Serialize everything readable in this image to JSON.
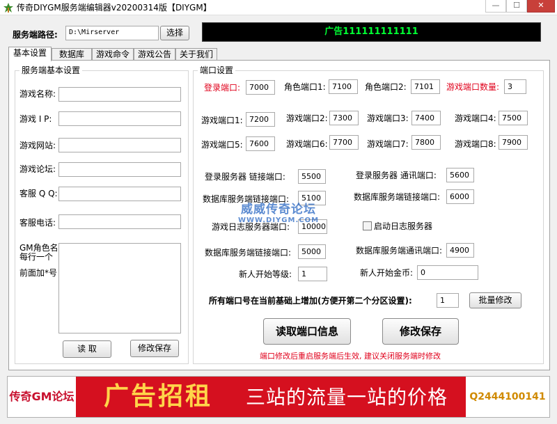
{
  "window": {
    "title": "传奇DIYGM服务端编辑器v20200314版【DIYGM】",
    "minimize_glyph": "—",
    "maximize_glyph": "☐",
    "close_glyph": "✕"
  },
  "server_path": {
    "label": "服务端路径:",
    "value": "D:\\Mirserver",
    "browse_label": "选择"
  },
  "ad_banner_text": "广告111111111111",
  "tabs": [
    {
      "label": "基本设置",
      "active": true
    },
    {
      "label": "数据库"
    },
    {
      "label": "游戏命令"
    },
    {
      "label": "游戏公告"
    },
    {
      "label": "关于我们"
    }
  ],
  "basic_settings": {
    "group_title": "服务端基本设置",
    "fields": [
      {
        "label": "游戏名称:",
        "value": ""
      },
      {
        "label": "游戏 I P:",
        "value": ""
      },
      {
        "label": "游戏网站:",
        "value": ""
      },
      {
        "label": "游戏论坛:",
        "value": ""
      },
      {
        "label": "客服 Q Q:",
        "value": ""
      },
      {
        "label": "客服电话:",
        "value": ""
      }
    ],
    "gm_label_lines": [
      "GM角色名:",
      "每行一个",
      "前面加*号"
    ],
    "gm_names": "",
    "read_button": "读 取",
    "save_button": "修改保存"
  },
  "ports": {
    "group_title": "端口设置",
    "row1": [
      {
        "label": "登录端口:",
        "value": "7000",
        "highlight": true
      },
      {
        "label": "角色端口1:",
        "value": "7100"
      },
      {
        "label": "角色端口2:",
        "value": "7101"
      },
      {
        "label": "游戏端口数量:",
        "value": "3",
        "highlight": true
      }
    ],
    "game_ports": [
      {
        "label": "游戏端口1:",
        "value": "7200"
      },
      {
        "label": "游戏端口2:",
        "value": "7300"
      },
      {
        "label": "游戏端口3:",
        "value": "7400"
      },
      {
        "label": "游戏端口4:",
        "value": "7500"
      },
      {
        "label": "游戏端口5:",
        "value": "7600"
      },
      {
        "label": "游戏端口6:",
        "value": "7700"
      },
      {
        "label": "游戏端口7:",
        "value": "7800"
      },
      {
        "label": "游戏端口8:",
        "value": "7900"
      }
    ],
    "login_link": {
      "label": "登录服务器  链接端口:",
      "value": "5500"
    },
    "login_comm": {
      "label": "登录服务器 通讯端口:",
      "value": "5600"
    },
    "db_link_a": {
      "label": "数据库服务端链接端口:",
      "value": "5100"
    },
    "db_link_b": {
      "label": "数据库服务端链接端口:",
      "value": "6000"
    },
    "log_port": {
      "label": "游戏日志服务器端口:",
      "value": "10000"
    },
    "log_checkbox_label": "启动日志服务器",
    "log_checkbox_checked": false,
    "db_link_c": {
      "label": "数据库服务端链接端口:",
      "value": "5000"
    },
    "db_comm": {
      "label": "数据库服务端通讯端口:",
      "value": "4900"
    },
    "new_level": {
      "label": "新人开始等级:",
      "value": "1"
    },
    "new_gold": {
      "label": "新人开始金币:",
      "value": "0"
    },
    "batch": {
      "label": "所有端口号在当前基础上增加(方便开第二个分区设置):",
      "value": "1",
      "button": "批量修改"
    },
    "read_button": "读取端口信息",
    "save_button": "修改保存",
    "note": "端口修改后重启服务端后生效, 建议关闭服务端时修改"
  },
  "watermark": {
    "main": "威威传奇论坛",
    "url": "WWW.DIYGM.COM"
  },
  "bottom_banner": {
    "left": "传奇GM论坛",
    "big": "广告招租",
    "slogan": "三站的流量一站的价格",
    "contact": "Q2444100141"
  },
  "colors": {
    "accent_red": "#e0001b",
    "banner_green": "#00ff33",
    "banner_red": "#d5101f",
    "banner_yellow": "#ffd54a"
  }
}
